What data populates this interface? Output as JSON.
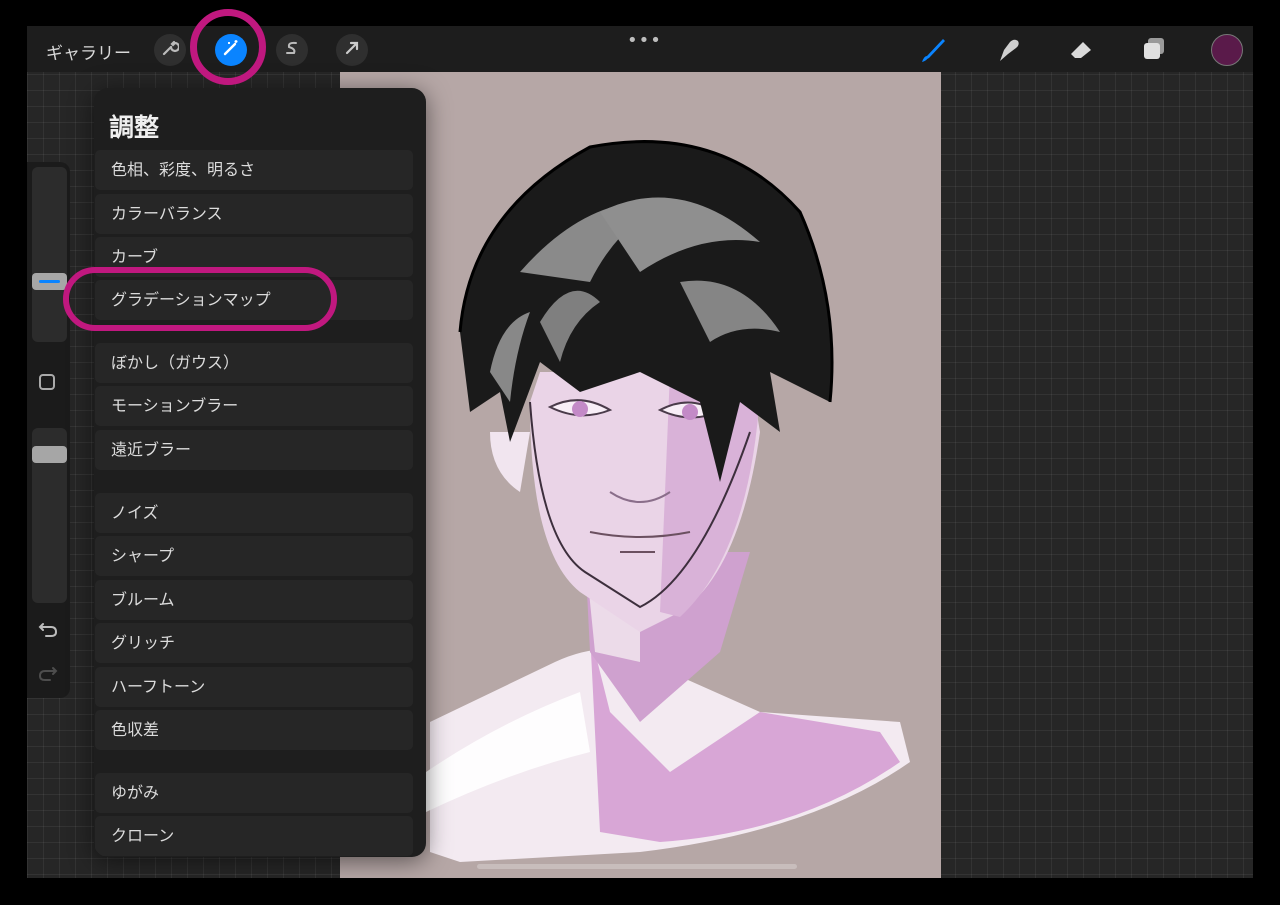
{
  "topbar": {
    "gallery_label": "ギャラリー",
    "tools": [
      {
        "name": "actions",
        "icon": "wrench-icon"
      },
      {
        "name": "adjustments",
        "icon": "magic-wand-icon",
        "active": true
      },
      {
        "name": "selection",
        "icon": "selection-s-icon"
      },
      {
        "name": "transform",
        "icon": "arrow-cursor-icon"
      }
    ],
    "more_label": "•••",
    "right_tools": [
      {
        "name": "brush",
        "icon": "brush-icon",
        "active": true
      },
      {
        "name": "smudge",
        "icon": "smudge-icon"
      },
      {
        "name": "eraser",
        "icon": "eraser-icon"
      },
      {
        "name": "layers",
        "icon": "layers-icon"
      }
    ],
    "current_color": "#5a1a4a"
  },
  "colors": {
    "accent": "#0a84ff",
    "highlight_ring": "#c0187f",
    "menu_bg": "#1e1e1e",
    "canvas_bg": "#b6a7a6"
  },
  "menu": {
    "title": "調整",
    "groups": [
      [
        "色相、彩度、明るさ",
        "カラーバランス",
        "カーブ",
        "グラデーションマップ"
      ],
      [
        "ぼかし（ガウス）",
        "モーションブラー",
        "遠近ブラー"
      ],
      [
        "ノイズ",
        "シャープ",
        "ブルーム",
        "グリッチ",
        "ハーフトーン",
        "色収差"
      ],
      [
        "ゆがみ",
        "クローン"
      ]
    ]
  }
}
